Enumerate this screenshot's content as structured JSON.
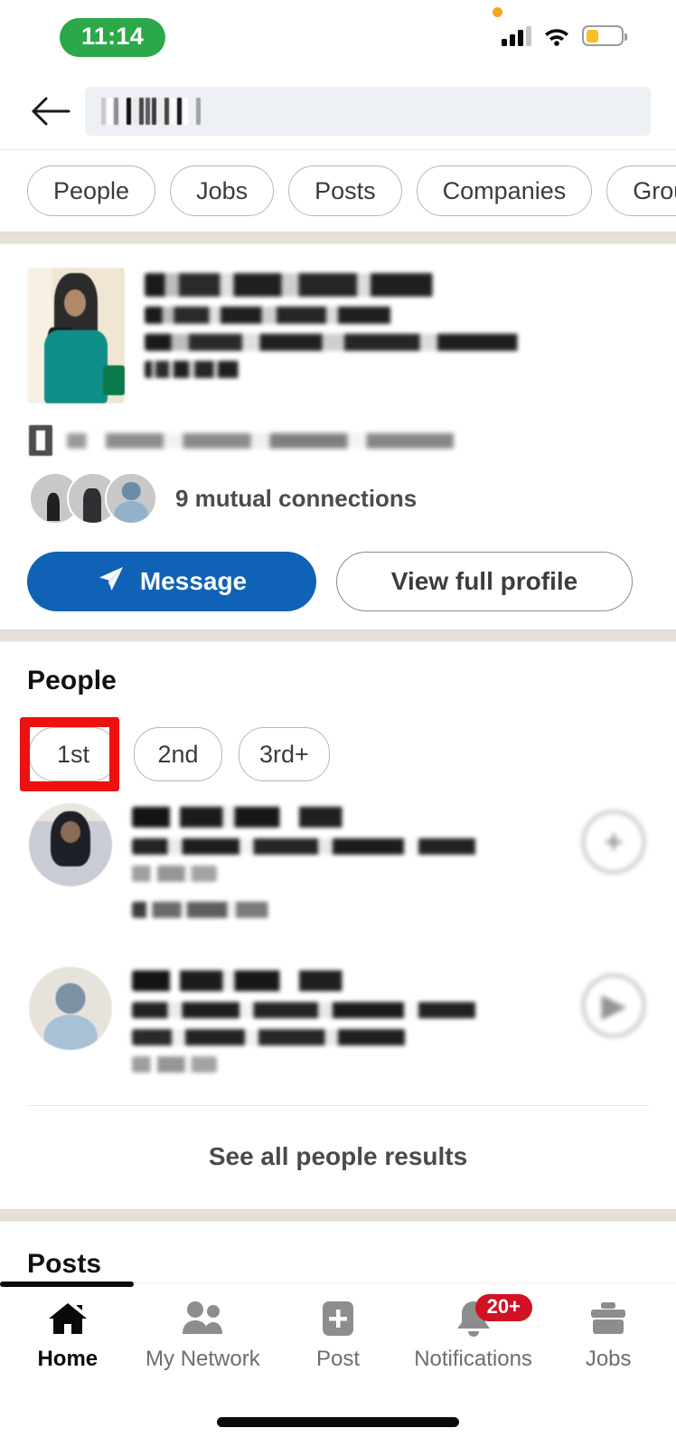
{
  "status_bar": {
    "time": "11:14",
    "icons": {
      "privacy_dot": "privacy-indicator-dot",
      "signal": "cellular-signal-icon",
      "wifi": "wifi-icon",
      "battery": "battery-low-power-icon"
    },
    "time_pill_color": "#2BA84A",
    "battery_fill_color": "#F6C026",
    "battery_level_percent": 36
  },
  "header": {
    "back_icon": "back-arrow-icon",
    "search": {
      "value": "",
      "placeholder": "",
      "redacted": true
    }
  },
  "filters": {
    "pills": [
      {
        "label": "People"
      },
      {
        "label": "Jobs"
      },
      {
        "label": "Posts"
      },
      {
        "label": "Companies"
      },
      {
        "label": "Groups"
      }
    ]
  },
  "profile_card": {
    "name": "",
    "headline": "",
    "subheadline": "",
    "location": "",
    "redacted": true,
    "meta_row_redacted": true,
    "mutual_connections": "9 mutual connections",
    "actions": {
      "message_label": "Message",
      "message_icon": "send-icon",
      "message_color": "#0F62B5",
      "view_profile_label": "View full profile"
    }
  },
  "people_section": {
    "title": "People",
    "degree_filters": [
      {
        "label": "1st",
        "highlighted": false
      },
      {
        "label": "2nd",
        "highlighted": false
      },
      {
        "label": "3rd+",
        "highlighted": true
      }
    ],
    "highlight_color": "#EE1111",
    "results": [
      {
        "name": "",
        "headline": "",
        "location": "",
        "tagline": "",
        "redacted": true,
        "action_icon": "connect-plus-icon",
        "avatar_type": "photo"
      },
      {
        "name": "",
        "headline": "",
        "headline2": "",
        "location": "",
        "redacted": true,
        "action_icon": "follow-icon",
        "avatar_type": "default"
      }
    ],
    "see_all_label": "See all people results"
  },
  "posts_section": {
    "title": "Posts"
  },
  "bottom_nav": {
    "items": [
      {
        "label": "Home",
        "icon": "home-icon",
        "active": true,
        "badge": null
      },
      {
        "label": "My Network",
        "icon": "my-network-icon",
        "active": false,
        "badge": null
      },
      {
        "label": "Post",
        "icon": "post-plus-icon",
        "active": false,
        "badge": null
      },
      {
        "label": "Notifications",
        "icon": "bell-icon",
        "active": false,
        "badge": "20+"
      },
      {
        "label": "Jobs",
        "icon": "briefcase-icon",
        "active": false,
        "badge": null
      }
    ],
    "badge_color": "#D11124"
  }
}
